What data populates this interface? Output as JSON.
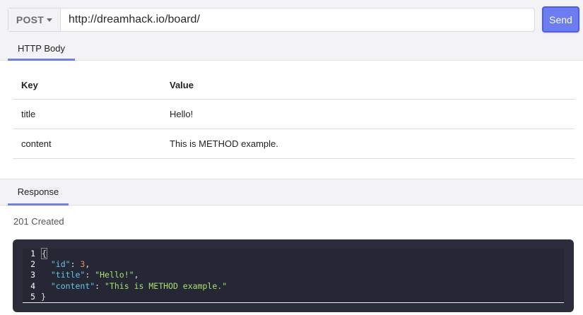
{
  "request": {
    "method": "POST",
    "url": "http://dreamhack.io/board/",
    "send_label": "Send"
  },
  "body_tab": "HTTP Body",
  "table": {
    "headers": {
      "key": "Key",
      "value": "Value"
    },
    "rows": [
      {
        "key": "title",
        "value": "Hello!"
      },
      {
        "key": "content",
        "value": "This is METHOD example."
      }
    ]
  },
  "response_tab": "Response",
  "response": {
    "status": "201 Created",
    "lines": [
      {
        "num": "1",
        "open": "{"
      },
      {
        "num": "2",
        "key": "\"id\"",
        "sep": ": ",
        "value": "3",
        "end": ",",
        "type": "number"
      },
      {
        "num": "3",
        "key": "\"title\"",
        "sep": ": ",
        "value": "\"Hello!\"",
        "end": ",",
        "type": "string"
      },
      {
        "num": "4",
        "key": "\"content\"",
        "sep": ": ",
        "value": "\"This is METHOD example.\"",
        "end": "",
        "type": "string"
      },
      {
        "num": "5",
        "close": "}"
      }
    ]
  },
  "colors": {
    "accent": "#6d7cf0",
    "code_bg": "#2c2d3b",
    "json_key": "#5fc8e8",
    "json_string": "#a6e06a",
    "json_number": "#f08a5d"
  }
}
